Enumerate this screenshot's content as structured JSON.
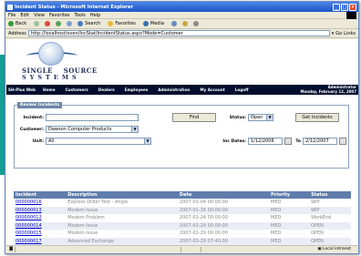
{
  "colors": {
    "teal_block": "#11a095",
    "navbar": "#000d2e",
    "table_header": "#5f7dab",
    "link": "#0000cc"
  },
  "window": {
    "title": "Incident Status - Microsoft Internet Explorer",
    "menu": [
      "File",
      "Edit",
      "View",
      "Favorites",
      "Tools",
      "Help"
    ],
    "toolbar": {
      "back": "Back",
      "search": "Search",
      "favorites": "Favorites",
      "media": "Media"
    },
    "address_label": "Address",
    "address_url": "http://localhost/oven/IncStat/IncidentStatus.aspx?Mode=Customer",
    "go": "Go",
    "links": "Links"
  },
  "header": {
    "logo_line1": "SINGLE    SOURCE",
    "logo_line2": "SYSTEMS",
    "nav_items": [
      "SH-Plus Web",
      "Home",
      "Customers",
      "Dealers",
      "Employees",
      "Administration",
      "My Account",
      "Logoff"
    ],
    "user": "Administrator",
    "date": "Monday, February 12, 2007"
  },
  "panel": {
    "title": "Review Incidents",
    "incident_label": "Incident:",
    "incident_value": "",
    "customer_label": "Customer:",
    "customer_value": "Dawson Computer Products",
    "unit_label": "Unit:",
    "unit_value": "All",
    "find_button": "Find",
    "status_label": "Status:",
    "status_value": "Open",
    "get_incidents_button": "Get Incidents",
    "dates_label": "Inc Dates:",
    "date_from": "1/12/2006",
    "to_label": "To",
    "date_to": "2/12/2007"
  },
  "table": {
    "columns": [
      "Incident",
      "Description",
      "Date",
      "Priority",
      "Status"
    ],
    "rows": [
      [
        "000000016",
        "Express Order Test - Angie",
        "2007-01-04 00:00:00",
        "MED",
        "WIP"
      ],
      [
        "000000013",
        "Modem Issue",
        "2007-01-16 00:00:00",
        "MED",
        "WIP"
      ],
      [
        "000000012",
        "Modem Problem",
        "2007-01-24 00:00:00",
        "MED",
        "WorkEnd"
      ],
      [
        "000000014",
        "Modem Issue",
        "2007-01-29 00:00:00",
        "MED",
        "OPEN"
      ],
      [
        "000000015",
        "Modem Issue",
        "2007-01-29 00:00:00",
        "MED",
        "OPEN"
      ],
      [
        "000000017",
        "Advanced Exchange",
        "2007-01-29 07:40:00",
        "MED",
        "OPEN"
      ]
    ]
  },
  "statusbar": {
    "zone": "Local intranet"
  }
}
